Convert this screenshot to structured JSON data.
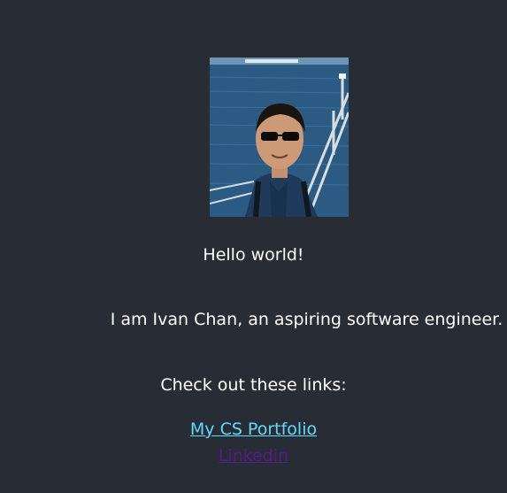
{
  "profile": {
    "photo_alt": "Profile photo of Ivan Chan"
  },
  "content": {
    "greeting": "Hello world!",
    "intro": "I am Ivan Chan, an aspiring software engineer.",
    "links_heading": "Check out these links:"
  },
  "links": [
    {
      "label": "My CS Portfolio",
      "color": "#61dafb"
    },
    {
      "label": "Linkedin",
      "color": "#551a8b"
    }
  ],
  "colors": {
    "background": "#282c34",
    "text": "#ffffff"
  }
}
